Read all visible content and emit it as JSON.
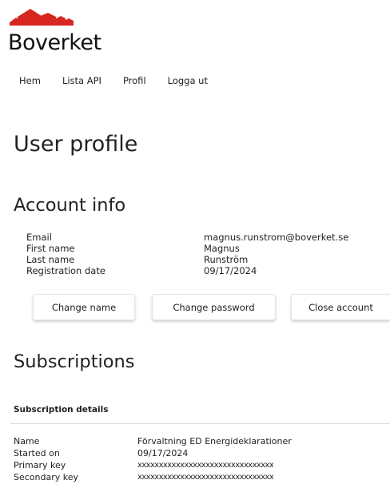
{
  "brand": {
    "name": "Boverket",
    "accent": "#d7261f"
  },
  "nav": {
    "items": [
      "Hem",
      "Lista API",
      "Profil",
      "Logga ut"
    ]
  },
  "page": {
    "title": "User profile"
  },
  "account": {
    "heading": "Account info",
    "fields": [
      {
        "label": "Email",
        "value": "magnus.runstrom@boverket.se"
      },
      {
        "label": "First name",
        "value": "Magnus"
      },
      {
        "label": "Last name",
        "value": "Runström"
      },
      {
        "label": "Registration date",
        "value": "09/17/2024"
      }
    ],
    "buttons": {
      "change_name": "Change name",
      "change_password": "Change password",
      "close_account": "Close account"
    }
  },
  "subscriptions": {
    "heading": "Subscriptions",
    "details_heading": "Subscription details",
    "fields": [
      {
        "label": "Name",
        "value": "Förvaltning ED Energideklarationer"
      },
      {
        "label": "Started on",
        "value": "09/17/2024"
      },
      {
        "label": "Primary key",
        "value": "xxxxxxxxxxxxxxxxxxxxxxxxxxxxxxxx"
      },
      {
        "label": "Secondary key",
        "value": "xxxxxxxxxxxxxxxxxxxxxxxxxxxxxxxx"
      }
    ]
  }
}
